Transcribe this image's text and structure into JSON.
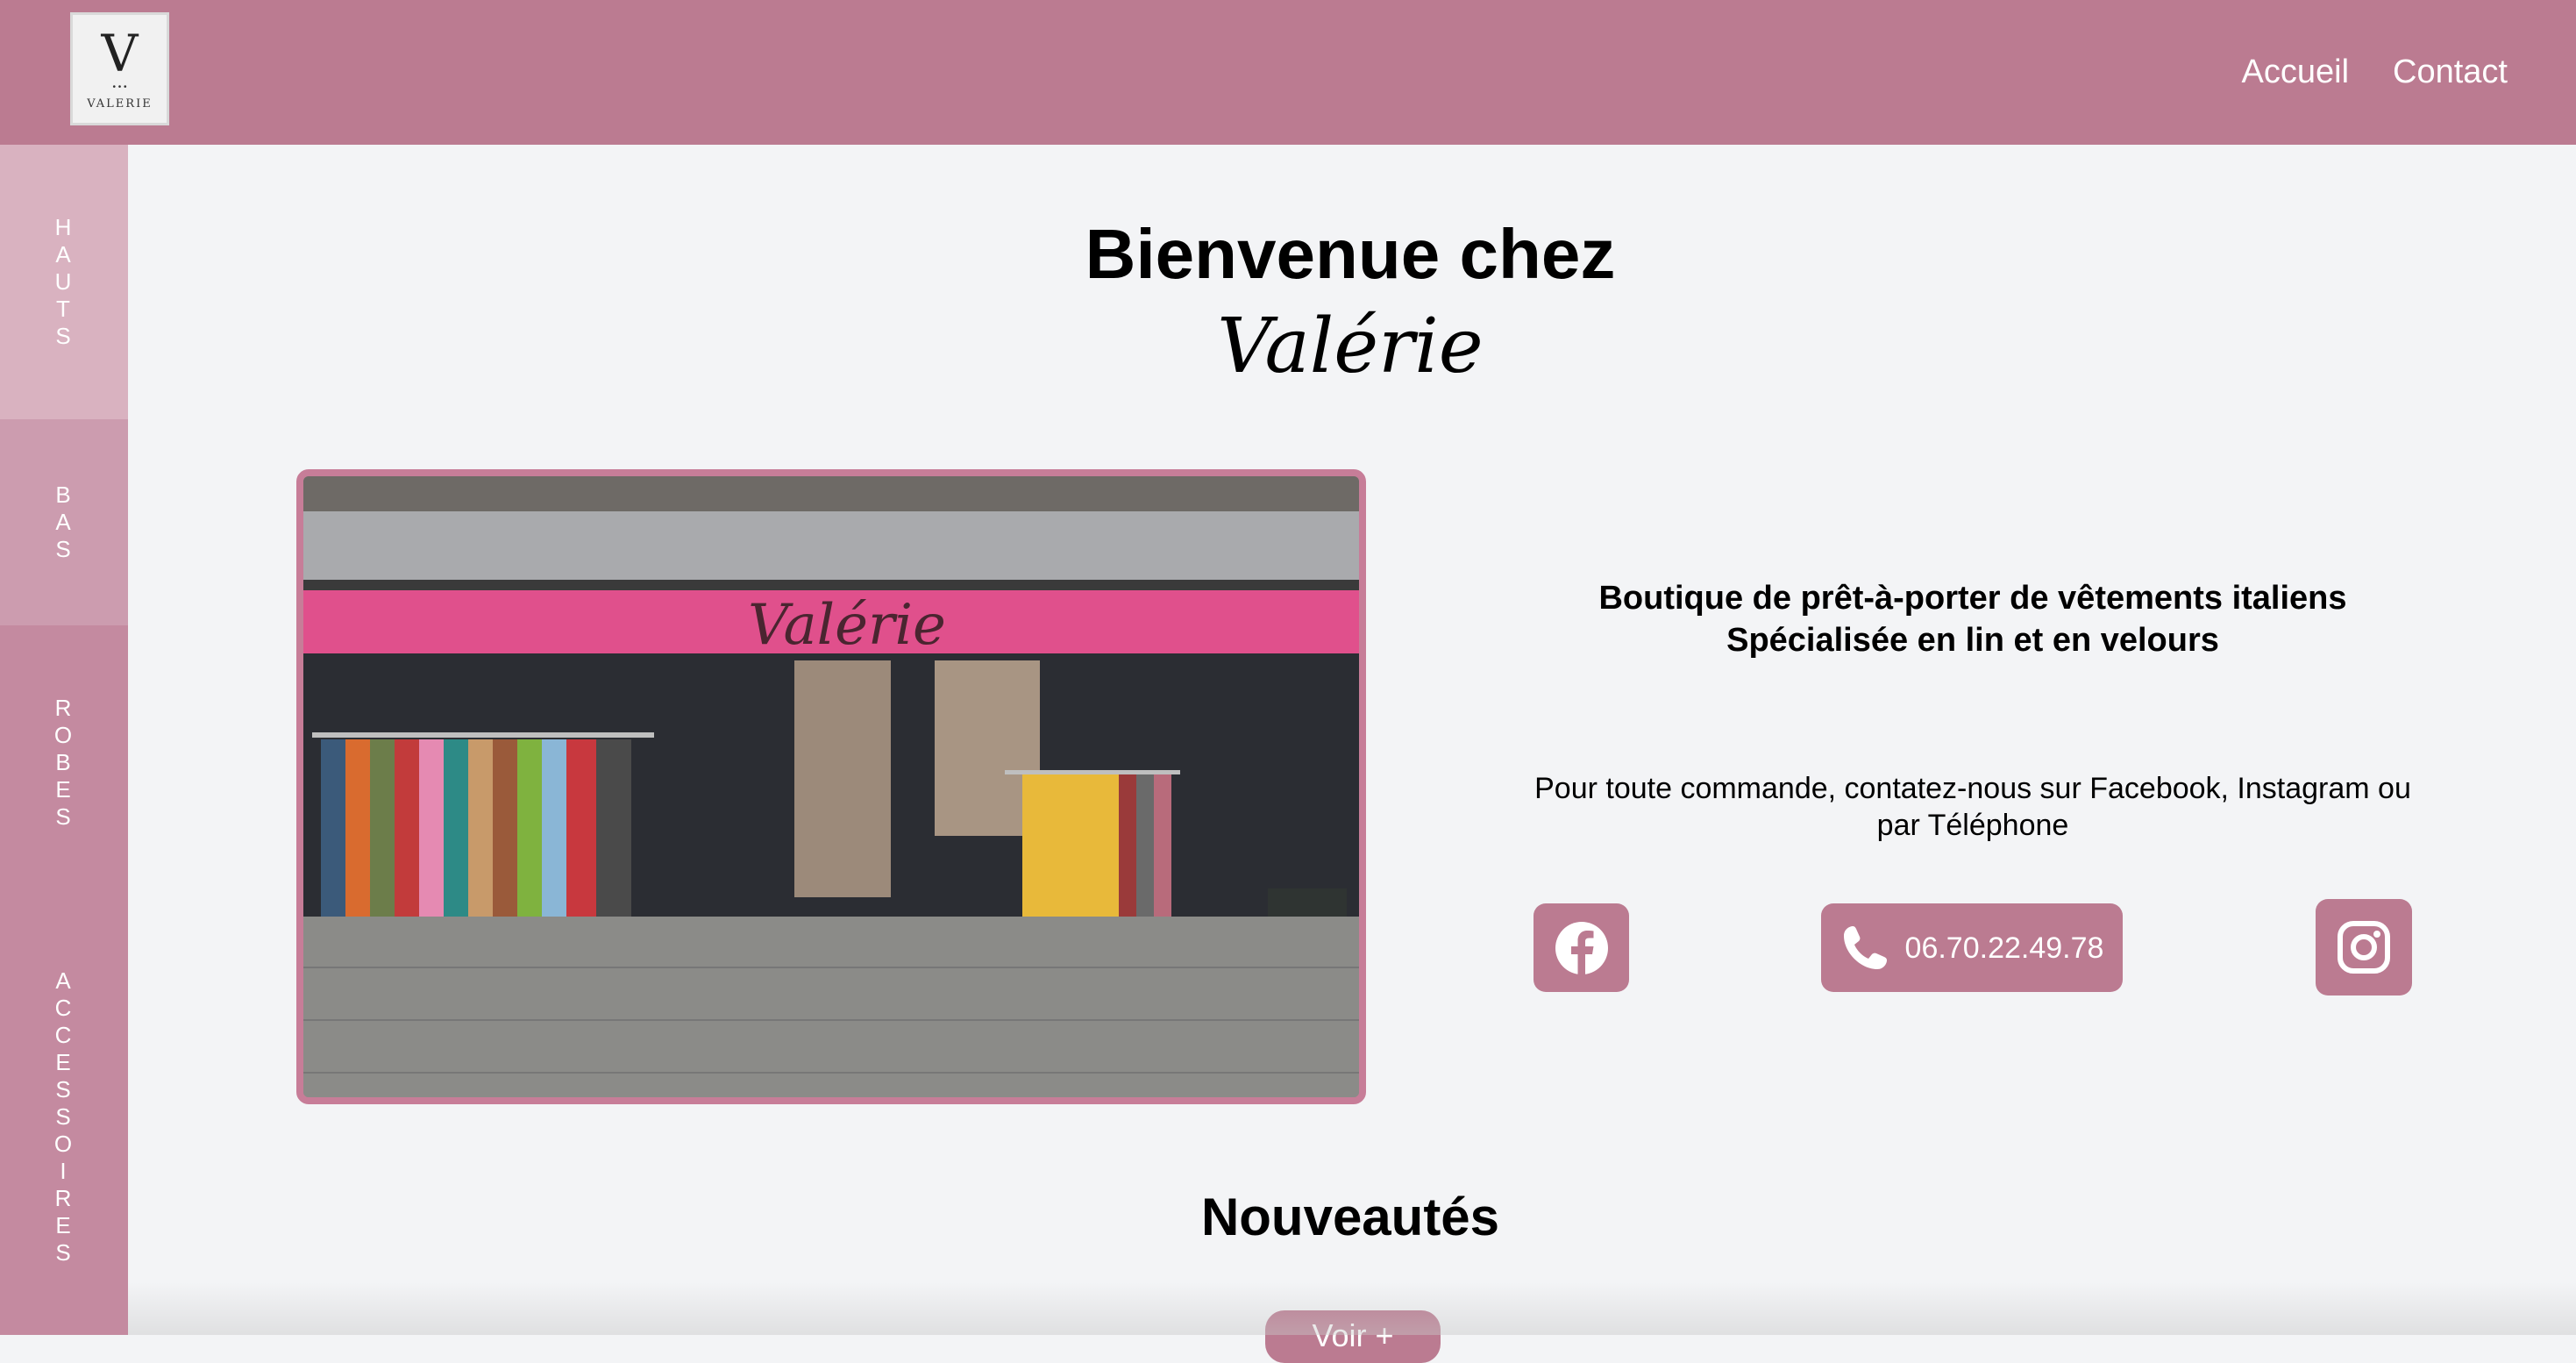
{
  "header": {
    "logo_letter": "V",
    "logo_dots": "• • •",
    "logo_text": "VALERIE",
    "nav": [
      {
        "label": "Accueil"
      },
      {
        "label": "Contact"
      }
    ]
  },
  "sidebar": {
    "items": [
      {
        "label": [
          "H",
          "A",
          "U",
          "T",
          "S"
        ]
      },
      {
        "label": [
          "B",
          "A",
          "S"
        ]
      },
      {
        "label": [
          "R",
          "O",
          "B",
          "E",
          "S"
        ]
      },
      {
        "label": [
          "A",
          "C",
          "C",
          "E",
          "S",
          "S",
          "O",
          "I",
          "R",
          "E",
          "S"
        ]
      }
    ]
  },
  "hero": {
    "title": "Bienvenue chez",
    "name": "Valérie"
  },
  "shop_photo": {
    "awning_text": "Valérie"
  },
  "description": {
    "line1": "Boutique de prêt-à-porter de vêtements italiens",
    "line2": "Spécialisée en lin et en velours",
    "order": "Pour toute commande, contatez-nous sur Facebook, Instagram ou par Téléphone"
  },
  "contact": {
    "phone": "06.70.22.49.78"
  },
  "news": {
    "title": "Nouveautés",
    "button": "Voir +"
  },
  "colors": {
    "brand": "#bb7b91",
    "background": "#f3f4f6"
  },
  "icons": [
    "facebook-icon",
    "phone-icon",
    "instagram-icon"
  ]
}
